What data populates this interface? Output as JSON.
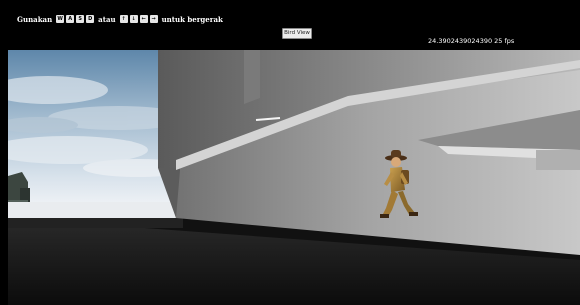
{
  "hud": {
    "hint": {
      "prefix": "Gunakan",
      "wasd_keys": [
        "W",
        "A",
        "S",
        "D"
      ],
      "middle": "atau",
      "arrow_keys": [
        "↑",
        "↓",
        "←",
        "→"
      ],
      "suffix": "untuk bergerak"
    },
    "bird_view_button": "Bird View",
    "fps_text": "24.3902439024390 25 fps"
  },
  "scene": {
    "sky_color": "#7fa3c4",
    "floor_color": "#1c1c1c",
    "wall_color": "#9d9d9d",
    "character": "explorer-character"
  }
}
